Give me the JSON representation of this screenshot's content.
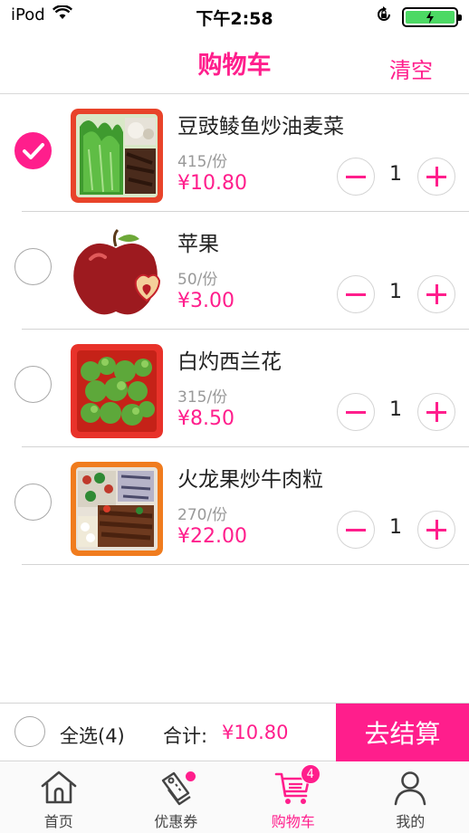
{
  "status_bar": {
    "carrier": "iPod",
    "time": "下午2:58"
  },
  "nav": {
    "title": "购物车",
    "clear_label": "清空"
  },
  "items": [
    {
      "name": "豆豉鲮鱼炒油麦菜",
      "weight": "415/份",
      "price": "¥10.80",
      "qty": "1",
      "checked": true,
      "image": "lettuce-dish"
    },
    {
      "name": "苹果",
      "weight": "50/份",
      "price": "¥3.00",
      "qty": "1",
      "checked": false,
      "image": "apple"
    },
    {
      "name": "白灼西兰花",
      "weight": "315/份",
      "price": "¥8.50",
      "qty": "1",
      "checked": false,
      "image": "broccoli-dish"
    },
    {
      "name": "火龙果炒牛肉粒",
      "weight": "270/份",
      "price": "¥22.00",
      "qty": "1",
      "checked": false,
      "image": "beef-dish"
    }
  ],
  "checkout": {
    "select_all_label": "全选(4)",
    "total_label": "合计:",
    "total_value": "¥10.80",
    "button_label": "去结算"
  },
  "tabs": [
    {
      "label": "首页",
      "icon": "home-icon"
    },
    {
      "label": "优惠券",
      "icon": "coupon-icon"
    },
    {
      "label": "购物车",
      "icon": "cart-icon",
      "badge": "4"
    },
    {
      "label": "我的",
      "icon": "user-icon"
    }
  ],
  "colors": {
    "accent": "#ff1e8c",
    "battery": "#4cd964"
  }
}
